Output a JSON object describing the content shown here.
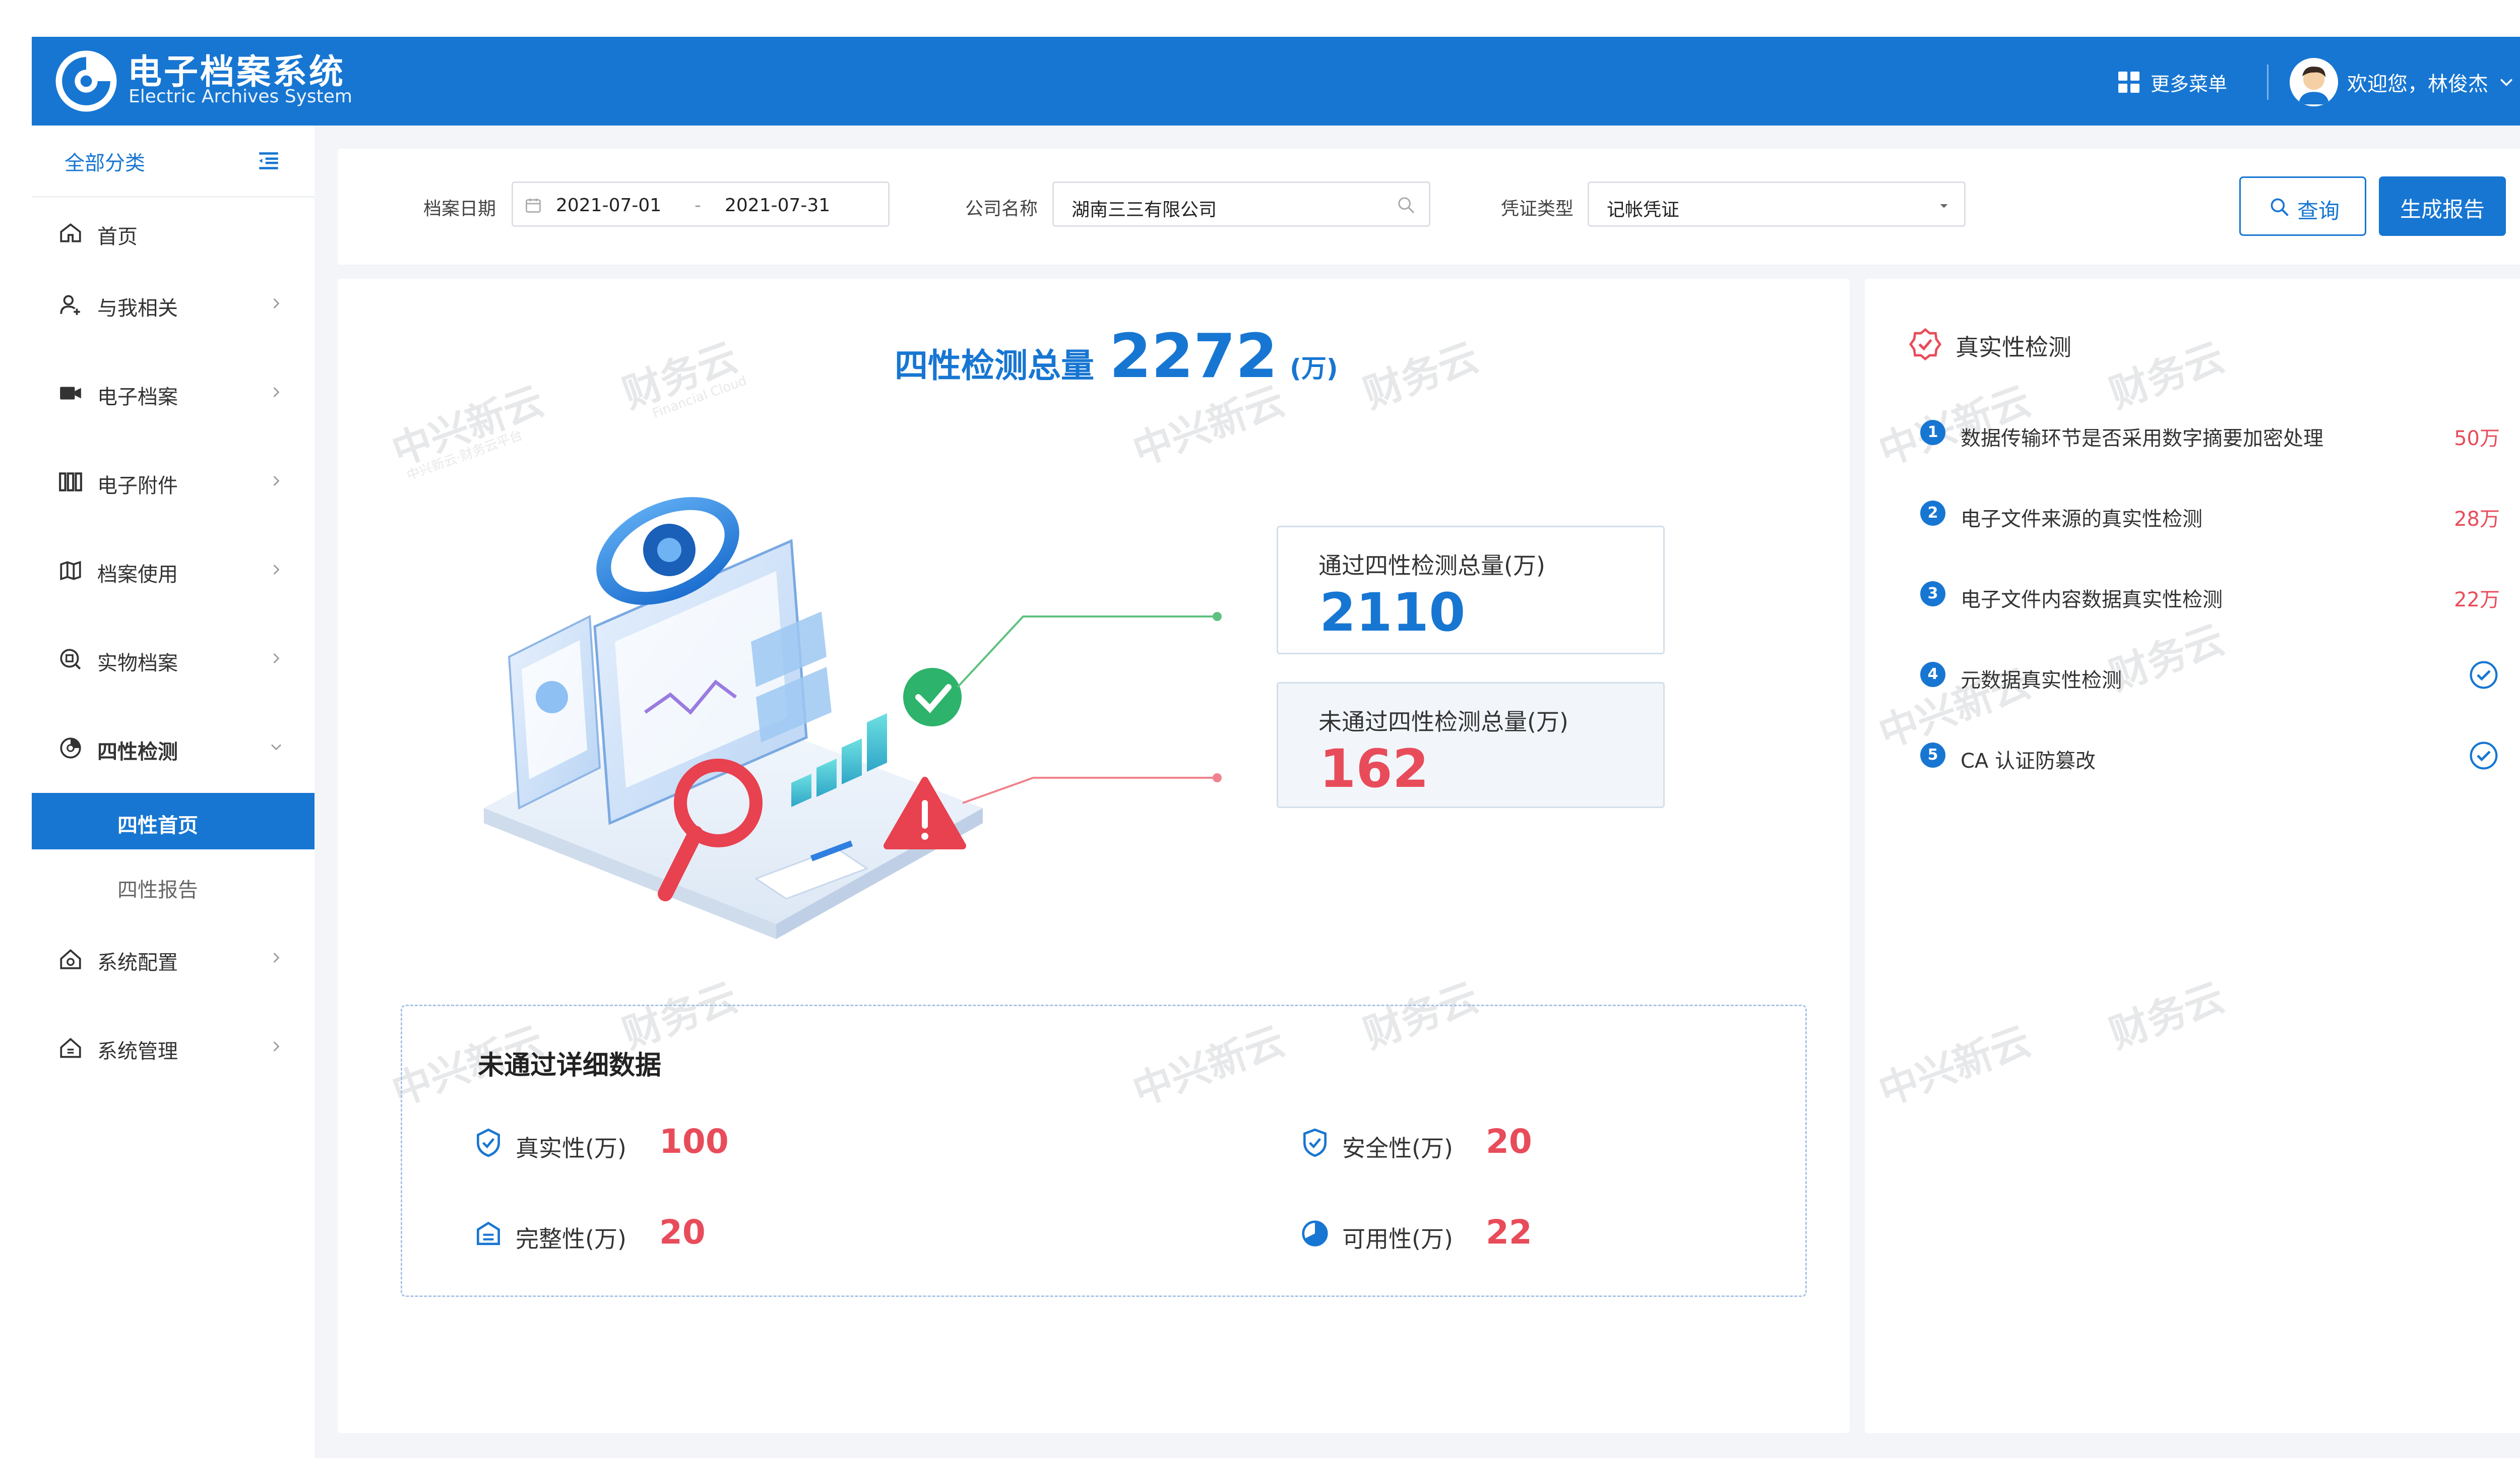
{
  "app": {
    "title": "电子档案系统",
    "subtitle": "Electric Archives System",
    "more_menu_label": "更多菜单",
    "user_greeting": "欢迎您，林俊杰"
  },
  "sidebar": {
    "header_label": "全部分类",
    "items": [
      {
        "label": "首页",
        "icon": "home-icon"
      },
      {
        "label": "与我相关",
        "icon": "user-icon"
      },
      {
        "label": "电子档案",
        "icon": "video-icon"
      },
      {
        "label": "电子附件",
        "icon": "books-icon"
      },
      {
        "label": "档案使用",
        "icon": "map-icon"
      },
      {
        "label": "实物档案",
        "icon": "stamp-icon"
      },
      {
        "label": "四性检测",
        "icon": "detection-icon"
      },
      {
        "label": "系统配置",
        "icon": "config-icon"
      },
      {
        "label": "系统管理",
        "icon": "manage-icon"
      }
    ],
    "sub_items": [
      {
        "label": "四性首页",
        "active": true
      },
      {
        "label": "四性报告",
        "active": false
      }
    ]
  },
  "filters": {
    "archive_date_label": "档案日期",
    "date_start": "2021-07-01",
    "date_separator": "-",
    "date_end": "2021-07-31",
    "company_label": "公司名称",
    "company_value": "湖南三三有限公司",
    "voucher_label": "凭证类型",
    "voucher_value": "记帐凭证",
    "query_button": "查询",
    "report_button": "生成报告"
  },
  "overview": {
    "total_label": "四性检测总量",
    "total_value": "2272",
    "total_unit": "(万)",
    "pass_label": "通过四性检测总量(万)",
    "pass_value": "2110",
    "fail_label": "未通过四性检测总量(万)",
    "fail_value": "162"
  },
  "details": {
    "title": "未通过详细数据",
    "metrics": [
      {
        "label": "真实性(万)",
        "value": "100",
        "icon": "shield-check-icon"
      },
      {
        "label": "安全性(万)",
        "value": "20",
        "icon": "shield-icon"
      },
      {
        "label": "完整性(万)",
        "value": "20",
        "icon": "stack-icon"
      },
      {
        "label": "可用性(万)",
        "value": "22",
        "icon": "pie-icon"
      }
    ]
  },
  "authenticity": {
    "title": "真实性检测",
    "checks": [
      {
        "num": "1",
        "label": "数据传输环节是否采用数字摘要加密处理",
        "value": "50万"
      },
      {
        "num": "2",
        "label": "电子文件来源的真实性检测",
        "value": "28万"
      },
      {
        "num": "3",
        "label": "电子文件内容数据真实性检测",
        "value": "22万"
      },
      {
        "num": "4",
        "label": "元数据真实性检测",
        "value": null,
        "status": "passed"
      },
      {
        "num": "5",
        "label": "CA 认证防篡改",
        "value": null,
        "status": "passed"
      }
    ]
  },
  "watermark": {
    "left_text": "中兴新云",
    "right_text": "财务云",
    "sub_left": "中兴新云·财务云平台",
    "sub_right": "Financial Cloud"
  },
  "colors": {
    "primary": "#1776d2",
    "danger": "#e84c5a",
    "success": "#2db36b",
    "background": "#f3f5f8"
  }
}
